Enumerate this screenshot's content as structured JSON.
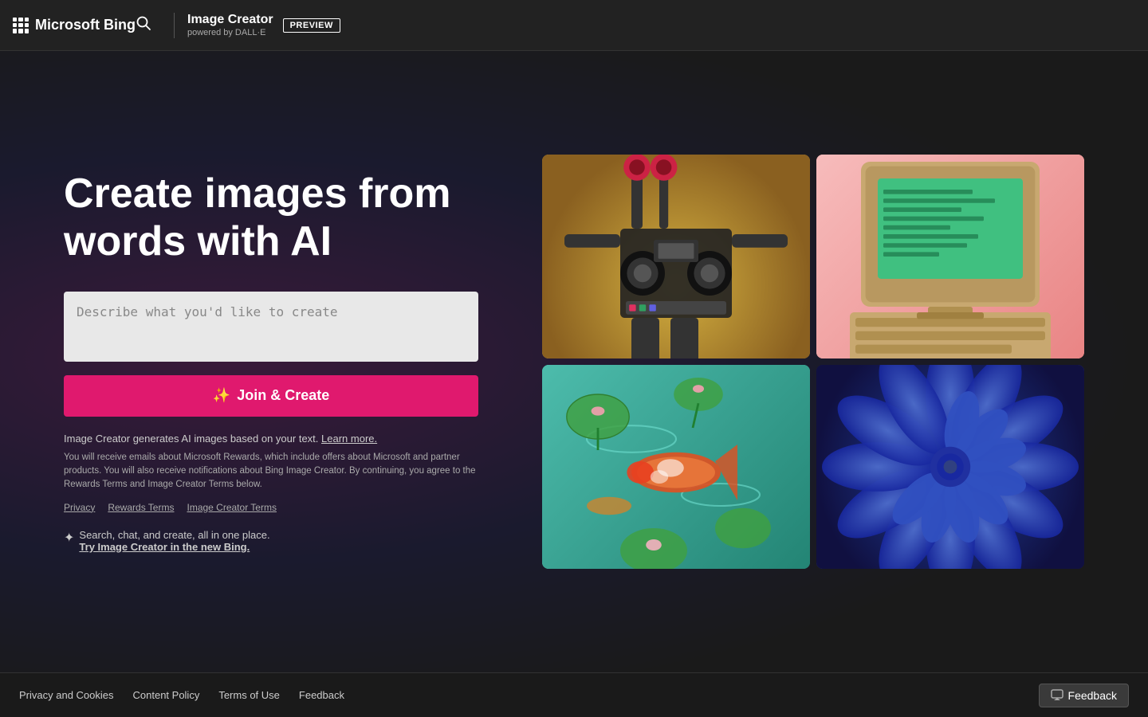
{
  "header": {
    "logo_text": "Microsoft Bing",
    "title": "Image Creator",
    "subtitle": "powered by DALL·E",
    "preview_label": "PREVIEW"
  },
  "main": {
    "headline_line1": "Create images from",
    "headline_line2": "words with AI",
    "prompt_placeholder": "Describe what you'd like to create",
    "join_button_label": "Join & Create",
    "info_text_prefix": "Image Creator generates AI images based on your text.",
    "learn_more_label": "Learn more.",
    "disclaimer": "You will receive emails about Microsoft Rewards, which include offers about Microsoft and partner products. You will also receive notifications about Bing Image Creator. By continuing, you agree to the Rewards Terms and Image Creator Terms below.",
    "links": [
      {
        "label": "Privacy"
      },
      {
        "label": "Rewards Terms"
      },
      {
        "label": "Image Creator Terms"
      }
    ],
    "promo_text": "Search, chat, and create, all in one place.",
    "promo_link": "Try Image Creator in the new Bing."
  },
  "footer": {
    "links": [
      {
        "label": "Privacy and Cookies"
      },
      {
        "label": "Content Policy"
      },
      {
        "label": "Terms of Use"
      },
      {
        "label": "Feedback"
      }
    ],
    "feedback_button_label": "Feedback"
  }
}
